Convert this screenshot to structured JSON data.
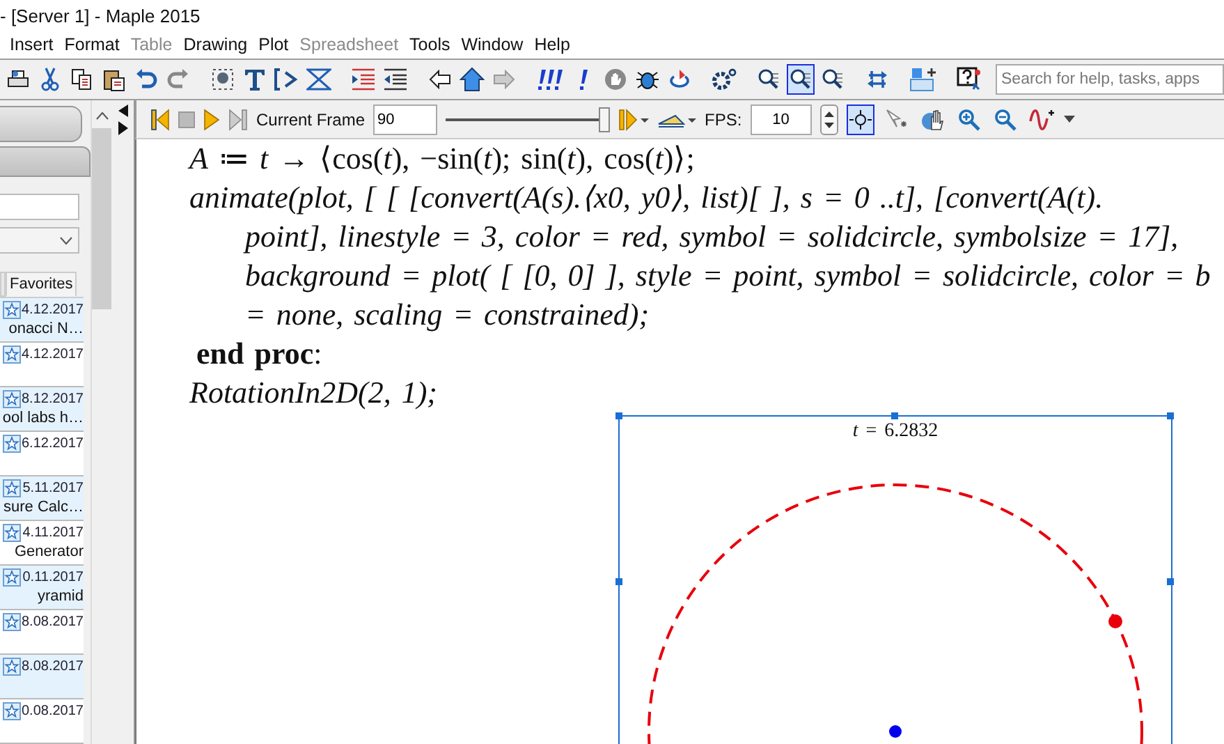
{
  "window": {
    "title": "- [Server 1] - Maple 2015"
  },
  "menu": [
    {
      "label": "Insert",
      "disabled": false
    },
    {
      "label": "Format",
      "disabled": false
    },
    {
      "label": "Table",
      "disabled": true
    },
    {
      "label": "Drawing",
      "disabled": false
    },
    {
      "label": "Plot",
      "disabled": false
    },
    {
      "label": "Spreadsheet",
      "disabled": true
    },
    {
      "label": "Tools",
      "disabled": false
    },
    {
      "label": "Window",
      "disabled": false
    },
    {
      "label": "Help",
      "disabled": false
    }
  ],
  "toolbar": {
    "tools": [
      {
        "kind": "print",
        "selected": false
      },
      {
        "kind": "cut",
        "selected": false
      },
      {
        "kind": "copy",
        "selected": false
      },
      {
        "kind": "paste",
        "selected": false
      },
      {
        "kind": "undo",
        "selected": false
      },
      {
        "kind": "redo",
        "selected": false
      },
      {
        "kind": "region",
        "selected": false
      },
      {
        "kind": "text",
        "selected": false
      },
      {
        "kind": "prompt",
        "selected": false
      },
      {
        "kind": "collapse",
        "selected": false
      },
      {
        "kind": "indent",
        "selected": false
      },
      {
        "kind": "outdent",
        "selected": false
      },
      {
        "kind": "back",
        "selected": false
      },
      {
        "kind": "home",
        "selected": false
      },
      {
        "kind": "forward",
        "selected": false
      },
      {
        "kind": "execute-all",
        "selected": false
      },
      {
        "kind": "execute",
        "selected": false
      },
      {
        "kind": "stop",
        "selected": false
      },
      {
        "kind": "debug",
        "selected": false
      },
      {
        "kind": "restart",
        "selected": false
      },
      {
        "kind": "gear",
        "selected": false
      },
      {
        "kind": "zoom",
        "selected": false
      },
      {
        "kind": "zoom",
        "selected": true
      },
      {
        "kind": "zoom",
        "selected": false
      },
      {
        "kind": "swap",
        "selected": false
      },
      {
        "kind": "insert",
        "selected": false
      },
      {
        "kind": "help",
        "selected": false
      }
    ],
    "search": {
      "placeholder": "Search for help, tasks, apps"
    }
  },
  "sidebar": {
    "tabs": [
      {
        "selected": false
      },
      {
        "label": "Favorites",
        "selected": true
      }
    ],
    "items": [
      {
        "date": "4.12.2017",
        "title": "onacci N…",
        "highlighted": true
      },
      {
        "date": "4.12.2017",
        "highlighted": false
      },
      {
        "date": "8.12.2017",
        "title": "ool labs h…",
        "highlighted": true
      },
      {
        "date": "6.12.2017",
        "highlighted": false
      },
      {
        "date": "5.11.2017",
        "title": "sure Calc…",
        "highlighted": true
      },
      {
        "date": "4.11.2017",
        "title": "Generator",
        "highlighted": false
      },
      {
        "date": "0.11.2017",
        "title": "yramid",
        "highlighted": true
      },
      {
        "date": "8.08.2017",
        "highlighted": false
      },
      {
        "date": "8.08.2017",
        "highlighted": true
      },
      {
        "date": "0.08.2017",
        "highlighted": false
      }
    ]
  },
  "animation_toolbar": {
    "current_frame_label": "Current Frame",
    "current_frame": "90",
    "slider": {
      "level": 1
    },
    "fps_label": "FPS:",
    "fps": "10",
    "tools": [
      {
        "kind": "crosshair",
        "selected": true
      },
      {
        "kind": "pointer",
        "selected": false
      },
      {
        "kind": "pan",
        "selected": false
      },
      {
        "kind": "zoom-in",
        "selected": false
      },
      {
        "kind": "zoom-out",
        "selected": false
      },
      {
        "kind": "curve",
        "selected": false
      }
    ]
  },
  "document": {
    "lines": [
      {
        "text": "*A* ≔ *t* → ⟨cos(*t*), −sin(*t*); sin(*t*), cos(*t*)⟩;",
        "kind": "code",
        "continuation": false
      },
      {
        "text": "animate(plot, [ [ [convert(A(s).⟨x0, y0⟩, list)[  ], s = 0 ..t], [convert(A(t).",
        "kind": "italic",
        "continuation": false
      },
      {
        "text": "point], linestyle = 3, color = red, symbol = solidcircle, symbolsize = 17],",
        "kind": "italic",
        "continuation": true
      },
      {
        "text": "background = plot( [ [0, 0] ], style = point, symbol = solidcircle, color = b",
        "kind": "italic",
        "continuation": true
      },
      {
        "text": "= none, scaling = constrained);",
        "kind": "italic",
        "continuation": true
      },
      {
        "text": "**end proc**:",
        "kind": "keyword",
        "continuation": false
      },
      {
        "text": "RotationIn2D(2, 1);",
        "kind": "italic",
        "continuation": false
      }
    ],
    "plot": {
      "title": "t = 6.2832",
      "selected": true
    }
  }
}
